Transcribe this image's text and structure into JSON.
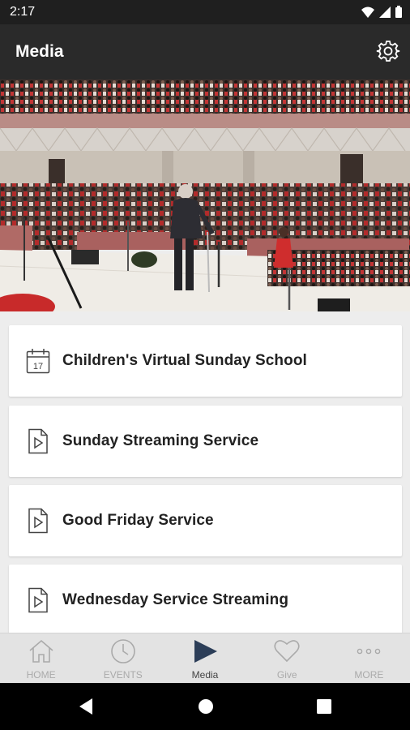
{
  "status": {
    "time": "2:17"
  },
  "header": {
    "title": "Media"
  },
  "hero": {
    "image": "church-sanctuary-photo"
  },
  "media_items": [
    {
      "label": "Children's Virtual Sunday School",
      "icon": "calendar-icon"
    },
    {
      "label": "Sunday Streaming Service",
      "icon": "video-file-icon"
    },
    {
      "label": "Good Friday Service",
      "icon": "video-file-icon"
    },
    {
      "label": "Wednesday Service Streaming",
      "icon": "video-file-icon"
    }
  ],
  "calendar_icon_day": "17",
  "tabs": [
    {
      "label": "HOME",
      "icon": "home-icon",
      "active": false
    },
    {
      "label": "EVENTS",
      "icon": "clock-icon",
      "active": false
    },
    {
      "label": "Media",
      "icon": "play-icon",
      "active": true
    },
    {
      "label": "Give",
      "icon": "heart-icon",
      "active": false
    },
    {
      "label": "MORE",
      "icon": "more-icon",
      "active": false
    }
  ],
  "colors": {
    "appbar": "#2a2a2a",
    "statusbar": "#1f1f1f",
    "active_tab": "#2c3e58"
  }
}
